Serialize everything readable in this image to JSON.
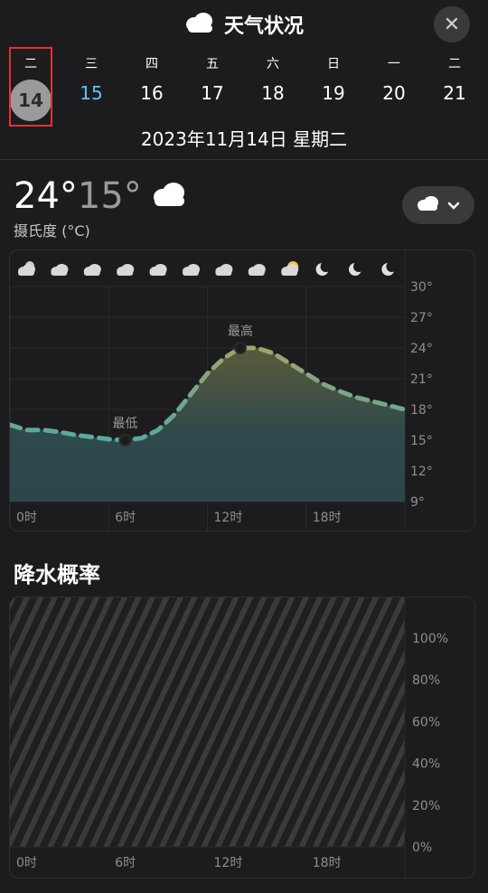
{
  "header": {
    "title": "天气状况",
    "close_label": "✕",
    "days": [
      {
        "weekday": "二",
        "date": "14",
        "selected": true
      },
      {
        "weekday": "三",
        "date": "15",
        "today": true
      },
      {
        "weekday": "四",
        "date": "16"
      },
      {
        "weekday": "五",
        "date": "17"
      },
      {
        "weekday": "六",
        "date": "18"
      },
      {
        "weekday": "日",
        "date": "19"
      },
      {
        "weekday": "一",
        "date": "20"
      },
      {
        "weekday": "二",
        "date": "21"
      }
    ],
    "date_line": "2023年11月14日 星期二"
  },
  "summary": {
    "high": "24°",
    "low": "15°",
    "unit": "摄氏度 (°C)",
    "condition_icon": "cloud-icon"
  },
  "temp_chart": {
    "hour_icons": [
      "cloud-moon-icon",
      "cloud-icon",
      "cloud-icon",
      "cloud-icon",
      "cloud-icon",
      "cloud-icon",
      "cloud-icon",
      "cloud-icon",
      "cloud-sun-icon",
      "moon-icon",
      "moon-icon",
      "moon-icon"
    ],
    "high_label": "最高",
    "low_label": "最低"
  },
  "rain": {
    "title": "降水概率"
  },
  "chart_data": [
    {
      "type": "area",
      "x": [
        0,
        1,
        2,
        3,
        4,
        5,
        6,
        7,
        8,
        9,
        10,
        11,
        12,
        13,
        14,
        15,
        16,
        17,
        18,
        19,
        20,
        21,
        22,
        23,
        24
      ],
      "values": [
        16.5,
        16,
        16,
        15.8,
        15.5,
        15.3,
        15.1,
        15,
        15.2,
        16,
        17.5,
        19.5,
        21.5,
        23,
        24,
        24,
        23.5,
        22.5,
        21.5,
        20.5,
        19.8,
        19.2,
        18.8,
        18.4,
        18
      ],
      "xticks": [
        "0时",
        "6时",
        "12时",
        "18时"
      ],
      "yticks": [
        "30°",
        "27°",
        "24°",
        "21°",
        "18°",
        "15°",
        "12°",
        "9°"
      ],
      "ylim": [
        9,
        30
      ],
      "annotations": [
        {
          "text": "最高",
          "x": 14,
          "y": 24
        },
        {
          "text": "最低",
          "x": 7,
          "y": 15
        }
      ]
    },
    {
      "type": "bar",
      "x": [
        0,
        6,
        12,
        18
      ],
      "xticks": [
        "0时",
        "6时",
        "12时",
        "18时"
      ],
      "yticks": [
        "100%",
        "80%",
        "60%",
        "40%",
        "20%",
        "0%"
      ],
      "ylim": [
        0,
        100
      ],
      "values": []
    }
  ]
}
